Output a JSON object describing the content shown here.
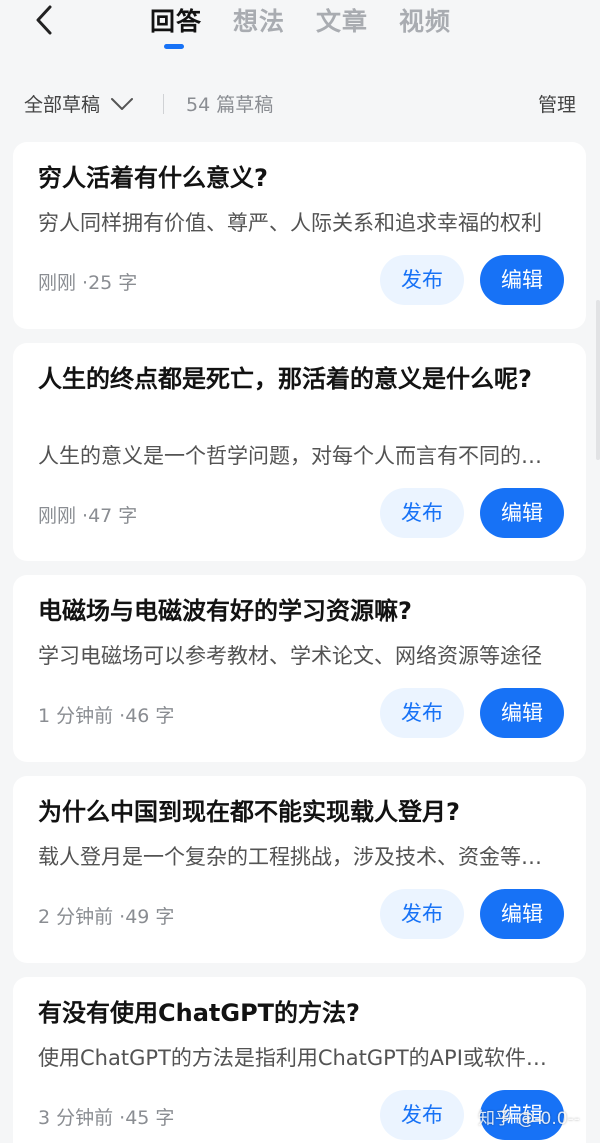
{
  "header": {
    "back_icon": "chevron-left-icon",
    "tabs": [
      {
        "label": "回答",
        "active": true
      },
      {
        "label": "想法",
        "active": false
      },
      {
        "label": "文章",
        "active": false
      },
      {
        "label": "视频",
        "active": false
      }
    ]
  },
  "filter": {
    "selected": "全部草稿",
    "dropdown_icon": "chevron-down-icon",
    "count_label": "54 篇草稿",
    "manage_label": "管理"
  },
  "drafts": [
    {
      "title": "穷人活着有什么意义?",
      "excerpt": "穷人同样拥有价值、尊严、人际关系和追求幸福的权利",
      "meta": "刚刚 ·25 字",
      "publish_label": "发布",
      "edit_label": "编辑"
    },
    {
      "title": "人生的终点都是死亡，那活着的意义是什么呢?",
      "excerpt": "人生的意义是一个哲学问题，对每个人而言有不同的答案",
      "meta": "刚刚 ·47 字",
      "publish_label": "发布",
      "edit_label": "编辑"
    },
    {
      "title": "电磁场与电磁波有好的学习资源嘛?",
      "excerpt": "学习电磁场可以参考教材、学术论文、网络资源等途径",
      "meta": "1 分钟前 ·46 字",
      "publish_label": "发布",
      "edit_label": "编辑"
    },
    {
      "title": "为什么中国到现在都不能实现载人登月?",
      "excerpt": "载人登月是一个复杂的工程挑战，涉及技术、资金等多方面",
      "meta": "2 分钟前 ·49 字",
      "publish_label": "发布",
      "edit_label": "编辑"
    },
    {
      "title": "有没有使用ChatGPT的方法?",
      "excerpt": "使用ChatGPT的方法是指利用ChatGPT的API或软件工具",
      "meta": "3 分钟前 ·45 字",
      "publish_label": "发布",
      "edit_label": "编辑"
    }
  ],
  "watermark": "知乎 @-0.0--",
  "colors": {
    "accent": "#1772f6",
    "publish_bg": "#ebf4ff",
    "background": "#f5f6f7",
    "card": "#ffffff"
  }
}
